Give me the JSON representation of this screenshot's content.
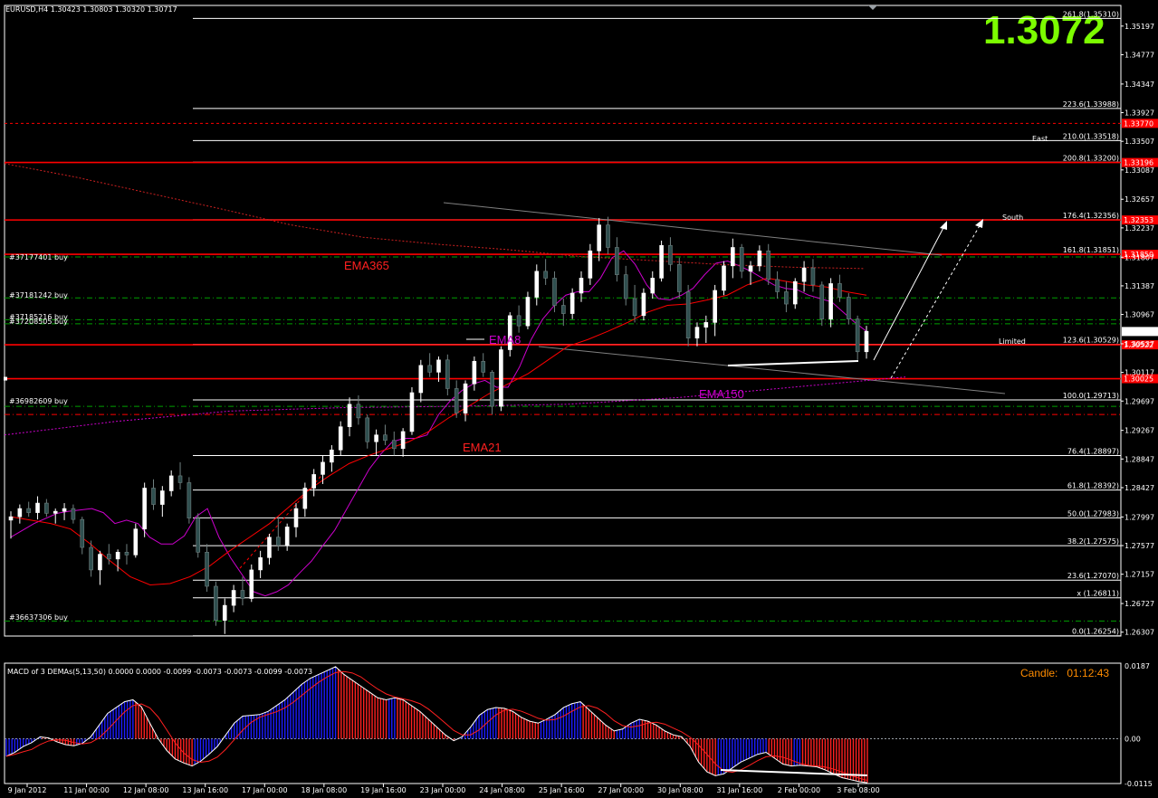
{
  "header": {
    "symbol_info": "EURUSD,H4  1.30423 1.30803 1.30320 1.30717"
  },
  "current_price": "1.3072",
  "price_tag": "1.30717",
  "macd": {
    "label": "MACD of 3 DEMAs(5,13,50) 0.0000 0.0000 -0.0099 -0.0073 -0.0073 -0.0099 -0.0073",
    "axis": [
      "0.0187",
      "0.00",
      "-0.0115"
    ]
  },
  "candle_timer": "Candle:   01:12:43",
  "colors": {
    "bull": "#ffffff",
    "bear": "#2f4f4f",
    "hline": "#ff0000",
    "fib": "#ffffff",
    "ema8": "#cc00cc",
    "ema21": "#ff0000",
    "macd_pos": "#1c1cff",
    "macd_neg": "#ff2020"
  },
  "labels": {
    "ema365": "EMA365",
    "ema8": "EMA8",
    "ema150": "EMA150",
    "ema21": "EMA21",
    "east": "East",
    "south": "South",
    "limited": "Limited"
  },
  "orders": [
    "#37177401 buy",
    "#37181242 buy",
    "#37185216 buy",
    "#37208505 buy",
    "#36982609 buy",
    "#36637306 buy"
  ],
  "chart_data": {
    "type": "candlestick",
    "ylim": [
      1.2625,
      1.355
    ],
    "price_axis": [
      "1.35197",
      "1.34777",
      "1.34347",
      "1.33927",
      "1.33507",
      "1.33087",
      "1.32657",
      "1.32237",
      "1.31807",
      "1.31387",
      "1.30967",
      "1.30537",
      "1.30117",
      "1.29697",
      "1.29267",
      "1.28847",
      "1.28427",
      "1.27997",
      "1.27577",
      "1.27157",
      "1.26727",
      "1.26307"
    ],
    "time_axis": [
      "9 Jan 2012",
      "11 Jan 00:00",
      "12 Jan 08:00",
      "13 Jan 16:00",
      "17 Jan 00:00",
      "18 Jan 08:00",
      "19 Jan 16:00",
      "23 Jan 00:00",
      "24 Jan 08:00",
      "25 Jan 16:00",
      "27 Jan 00:00",
      "30 Jan 08:00",
      "31 Jan 16:00",
      "2 Feb 00:00",
      "3 Feb 08:00"
    ],
    "fib_levels": [
      {
        "label": "261.8(1.35310)",
        "price": 1.3531
      },
      {
        "label": "223.6(1.33988)",
        "price": 1.33988
      },
      {
        "label": "210.0(1.33518)",
        "price": 1.33518
      },
      {
        "label": "200.8(1.33200)",
        "price": 1.332
      },
      {
        "label": "176.4(1.32356)",
        "price": 1.32356
      },
      {
        "label": "161.8(1.31851)",
        "price": 1.31851
      },
      {
        "label": "123.6(1.30529)",
        "price": 1.30529
      },
      {
        "label": "100.0(1.29713)",
        "price": 1.29713
      },
      {
        "label": "76.4(1.28897)",
        "price": 1.28897
      },
      {
        "label": "61.8(1.28392)",
        "price": 1.28392
      },
      {
        "label": "50.0(1.27983)",
        "price": 1.27983
      },
      {
        "label": "38.2(1.27575)",
        "price": 1.27575
      },
      {
        "label": "23.6(1.27070)",
        "price": 1.2707
      },
      {
        "label": "x (1.26811)",
        "price": 1.26811
      },
      {
        "label": "0.0(1.26254)",
        "price": 1.26254
      }
    ],
    "red_levels": [
      {
        "label": "1.33770",
        "price": 1.3377,
        "style": "dotted"
      },
      {
        "label": "1.33196",
        "price": 1.33196,
        "style": "solid"
      },
      {
        "label": "1.32353",
        "price": 1.32353,
        "style": "solid"
      },
      {
        "label": "1.31850",
        "price": 1.3185,
        "style": "solid"
      },
      {
        "label": "1.30522",
        "price": 1.30522,
        "style": "solid"
      },
      {
        "label": "1.30025",
        "price": 1.30025,
        "style": "solid"
      },
      {
        "label": "",
        "price": 1.295,
        "style": "dashdot"
      }
    ],
    "green_levels": [
      1.3181,
      1.3121,
      1.3089,
      1.3083,
      1.2962,
      1.2647
    ],
    "candles": [
      [
        1.2795,
        1.2808,
        1.2768,
        1.28
      ],
      [
        1.28,
        1.2818,
        1.279,
        1.2812
      ],
      [
        1.2812,
        1.2822,
        1.28,
        1.2806
      ],
      [
        1.2806,
        1.283,
        1.2796,
        1.282
      ],
      [
        1.282,
        1.2826,
        1.28,
        1.2805
      ],
      [
        1.2805,
        1.2812,
        1.279,
        1.2808
      ],
      [
        1.2808,
        1.282,
        1.2795,
        1.2812
      ],
      [
        1.2812,
        1.2818,
        1.279,
        1.2796
      ],
      [
        1.2796,
        1.28,
        1.2745,
        1.2755
      ],
      [
        1.2755,
        1.2765,
        1.2712,
        1.2722
      ],
      [
        1.2722,
        1.275,
        1.27,
        1.2745
      ],
      [
        1.2745,
        1.276,
        1.273,
        1.2738
      ],
      [
        1.2738,
        1.2752,
        1.272,
        1.2748
      ],
      [
        1.2748,
        1.276,
        1.273,
        1.2744
      ],
      [
        1.2744,
        1.279,
        1.274,
        1.2782
      ],
      [
        1.2782,
        1.285,
        1.277,
        1.2842
      ],
      [
        1.2842,
        1.2855,
        1.281,
        1.2818
      ],
      [
        1.2818,
        1.2845,
        1.28,
        1.2838
      ],
      [
        1.2838,
        1.2868,
        1.283,
        1.286
      ],
      [
        1.286,
        1.288,
        1.284,
        1.285
      ],
      [
        1.285,
        1.2858,
        1.279,
        1.2798
      ],
      [
        1.2798,
        1.2805,
        1.274,
        1.2748
      ],
      [
        1.2748,
        1.276,
        1.269,
        1.2698
      ],
      [
        1.2698,
        1.2705,
        1.264,
        1.2648
      ],
      [
        1.2648,
        1.268,
        1.2628,
        1.267
      ],
      [
        1.267,
        1.27,
        1.266,
        1.2692
      ],
      [
        1.2692,
        1.2712,
        1.267,
        1.268
      ],
      [
        1.268,
        1.273,
        1.2675,
        1.2722
      ],
      [
        1.2722,
        1.275,
        1.271,
        1.274
      ],
      [
        1.274,
        1.2775,
        1.273,
        1.277
      ],
      [
        1.277,
        1.28,
        1.275,
        1.2758
      ],
      [
        1.2758,
        1.279,
        1.275,
        1.2785
      ],
      [
        1.2785,
        1.282,
        1.277,
        1.2812
      ],
      [
        1.2812,
        1.285,
        1.28,
        1.2842
      ],
      [
        1.2842,
        1.287,
        1.283,
        1.2862
      ],
      [
        1.2862,
        1.289,
        1.2848,
        1.288
      ],
      [
        1.288,
        1.2905,
        1.2866,
        1.2898
      ],
      [
        1.2898,
        1.294,
        1.289,
        1.2932
      ],
      [
        1.2932,
        1.2975,
        1.2918,
        1.2965
      ],
      [
        1.2965,
        1.2978,
        1.2935,
        1.2945
      ],
      [
        1.2945,
        1.295,
        1.29,
        1.291
      ],
      [
        1.291,
        1.2928,
        1.289,
        1.292
      ],
      [
        1.292,
        1.2935,
        1.2905,
        1.2912
      ],
      [
        1.2912,
        1.2925,
        1.289,
        1.29
      ],
      [
        1.29,
        1.293,
        1.2888,
        1.2925
      ],
      [
        1.2925,
        1.299,
        1.292,
        1.2982
      ],
      [
        1.2982,
        1.303,
        1.2968,
        1.3022
      ],
      [
        1.3022,
        1.304,
        1.3005,
        1.3012
      ],
      [
        1.3012,
        1.3035,
        1.2998,
        1.303
      ],
      [
        1.303,
        1.3038,
        1.2978,
        1.2988
      ],
      [
        1.2988,
        1.3,
        1.2945,
        1.2952
      ],
      [
        1.2952,
        1.3,
        1.294,
        1.2995
      ],
      [
        1.2995,
        1.3035,
        1.2985,
        1.3028
      ],
      [
        1.3028,
        1.304,
        1.3005,
        1.3012
      ],
      [
        1.3012,
        1.3015,
        1.295,
        1.2962
      ],
      [
        1.2962,
        1.305,
        1.2955,
        1.3045
      ],
      [
        1.3045,
        1.31,
        1.3035,
        1.3095
      ],
      [
        1.3095,
        1.311,
        1.307,
        1.308
      ],
      [
        1.308,
        1.313,
        1.3075,
        1.3122
      ],
      [
        1.3122,
        1.317,
        1.311,
        1.316
      ],
      [
        1.316,
        1.3178,
        1.314,
        1.315
      ],
      [
        1.315,
        1.316,
        1.31,
        1.311
      ],
      [
        1.311,
        1.312,
        1.308,
        1.3098
      ],
      [
        1.3098,
        1.3135,
        1.309,
        1.3128
      ],
      [
        1.3128,
        1.316,
        1.3115,
        1.315
      ],
      [
        1.315,
        1.32,
        1.314,
        1.319
      ],
      [
        1.319,
        1.3238,
        1.3175,
        1.3228
      ],
      [
        1.3228,
        1.324,
        1.3185,
        1.3195
      ],
      [
        1.3195,
        1.321,
        1.3145,
        1.3155
      ],
      [
        1.3155,
        1.3168,
        1.311,
        1.312
      ],
      [
        1.312,
        1.314,
        1.3085,
        1.3095
      ],
      [
        1.3095,
        1.3135,
        1.3088,
        1.3128
      ],
      [
        1.3128,
        1.316,
        1.312,
        1.315
      ],
      [
        1.315,
        1.3205,
        1.3145,
        1.3198
      ],
      [
        1.3198,
        1.321,
        1.316,
        1.317
      ],
      [
        1.317,
        1.318,
        1.312,
        1.313
      ],
      [
        1.313,
        1.314,
        1.305,
        1.3062
      ],
      [
        1.3062,
        1.3085,
        1.305,
        1.3078
      ],
      [
        1.3078,
        1.3095,
        1.3055,
        1.3085
      ],
      [
        1.3085,
        1.314,
        1.3065,
        1.3132
      ],
      [
        1.3132,
        1.3175,
        1.3125,
        1.3168
      ],
      [
        1.3168,
        1.3208,
        1.315,
        1.3195
      ],
      [
        1.3195,
        1.32,
        1.315,
        1.316
      ],
      [
        1.316,
        1.3175,
        1.314,
        1.3168
      ],
      [
        1.3168,
        1.3198,
        1.316,
        1.319
      ],
      [
        1.319,
        1.32,
        1.314,
        1.3148
      ],
      [
        1.3148,
        1.316,
        1.312,
        1.313
      ],
      [
        1.313,
        1.3145,
        1.31,
        1.3112
      ],
      [
        1.3112,
        1.315,
        1.3105,
        1.3145
      ],
      [
        1.3145,
        1.3175,
        1.313,
        1.3165
      ],
      [
        1.3165,
        1.3178,
        1.313,
        1.314
      ],
      [
        1.314,
        1.3145,
        1.308,
        1.309
      ],
      [
        1.309,
        1.315,
        1.3078,
        1.3142
      ],
      [
        1.3142,
        1.3155,
        1.3115,
        1.3122
      ],
      [
        1.3122,
        1.3128,
        1.3082,
        1.309
      ],
      [
        1.309,
        1.3095,
        1.303,
        1.3042
      ],
      [
        1.3042,
        1.308,
        1.3032,
        1.3072
      ]
    ],
    "ema8": [
      1.277,
      1.279,
      1.2805,
      1.2808,
      1.281,
      1.2812,
      1.2806,
      1.279,
      1.2795,
      1.279,
      1.277,
      1.276,
      1.276,
      1.2772,
      1.28,
      1.2812,
      1.277,
      1.274,
      1.2715,
      1.269,
      1.2684,
      1.269,
      1.27,
      1.2718,
      1.2735,
      1.2758,
      1.278,
      1.281,
      1.284,
      1.287,
      1.2892,
      1.291,
      1.2915,
      1.2915,
      1.292,
      1.295,
      1.297,
      1.2985,
      1.2995,
      1.3,
      1.299,
      1.299,
      1.302,
      1.306,
      1.309,
      1.311,
      1.3125,
      1.313,
      1.313,
      1.315,
      1.318,
      1.319,
      1.317,
      1.314,
      1.312,
      1.3118,
      1.3125,
      1.3135,
      1.3155,
      1.3172,
      1.3175,
      1.3168,
      1.316,
      1.315,
      1.314,
      1.3135,
      1.3133,
      1.3125,
      1.312,
      1.3115,
      1.31,
      1.3085,
      1.3072
    ],
    "ema8_x": [
      0,
      4,
      8,
      10,
      12,
      14,
      16,
      18,
      20,
      22,
      24,
      26,
      28,
      30,
      32,
      34,
      36,
      38,
      40,
      42,
      44,
      46,
      48,
      50,
      52,
      54,
      56,
      58,
      60,
      62,
      64,
      66,
      68,
      70,
      72,
      74,
      76,
      78,
      80,
      82,
      84,
      86,
      88,
      90,
      92,
      94,
      96,
      98,
      100,
      102,
      104,
      106,
      108,
      110,
      112,
      114,
      116,
      118,
      120,
      122,
      124,
      126,
      128,
      130,
      132,
      134,
      136,
      138,
      140,
      142,
      144,
      146,
      148
    ],
    "ema21": [
      1.28,
      1.2795,
      1.279,
      1.2782,
      1.276,
      1.2735,
      1.2712,
      1.27,
      1.2702,
      1.2712,
      1.2728,
      1.275,
      1.277,
      1.279,
      1.2815,
      1.284,
      1.286,
      1.2878,
      1.289,
      1.29,
      1.291,
      1.2925,
      1.2945,
      1.2962,
      1.298,
      1.2995,
      1.301,
      1.303,
      1.305,
      1.306,
      1.3072,
      1.3085,
      1.31,
      1.311,
      1.3112,
      1.3118,
      1.3125,
      1.314,
      1.315,
      1.3145,
      1.314,
      1.3137,
      1.313,
      1.3125
    ],
    "ema150": [
      1.292,
      1.294,
      1.2955,
      1.296,
      1.2962,
      1.2965,
      1.2975,
      1.299,
      1.3005
    ],
    "ema365": [
      1.3318,
      1.3298,
      1.3275,
      1.3252,
      1.3228,
      1.321,
      1.32,
      1.3192,
      1.3182,
      1.3176,
      1.317,
      1.3166,
      1.3164
    ],
    "macd_hist": [
      -0.0045,
      -0.0035,
      -0.002,
      -0.001,
      0.0005,
      0.0002,
      -0.0008,
      -0.0015,
      -0.0018,
      -0.0012,
      0.0005,
      0.0035,
      0.0065,
      0.008,
      0.0095,
      0.01,
      0.0082,
      0.004,
      0.0,
      -0.003,
      -0.0052,
      -0.0062,
      -0.007,
      -0.0058,
      -0.004,
      -0.002,
      0.001,
      0.004,
      0.0058,
      0.006,
      0.0062,
      0.007,
      0.0085,
      0.01,
      0.012,
      0.014,
      0.0155,
      0.0165,
      0.0175,
      0.0185,
      0.0165,
      0.015,
      0.0135,
      0.012,
      0.0105,
      0.01,
      0.0105,
      0.01,
      0.0085,
      0.007,
      0.005,
      0.003,
      0.001,
      -0.0005,
      0.0005,
      0.003,
      0.006,
      0.0075,
      0.008,
      0.0078,
      0.007,
      0.0055,
      0.0045,
      0.004,
      0.005,
      0.0062,
      0.008,
      0.009,
      0.0095,
      0.0075,
      0.0055,
      0.0035,
      0.002,
      0.0025,
      0.004,
      0.005,
      0.0045,
      0.0035,
      0.002,
      0.001,
      0.0005,
      -0.002,
      -0.006,
      -0.0085,
      -0.0095,
      -0.009,
      -0.0075,
      -0.006,
      -0.005,
      -0.004,
      -0.0035,
      -0.005,
      -0.0065,
      -0.007,
      -0.0068,
      -0.007,
      -0.0072,
      -0.008,
      -0.009,
      -0.01,
      -0.0105,
      -0.011,
      -0.0113
    ]
  }
}
